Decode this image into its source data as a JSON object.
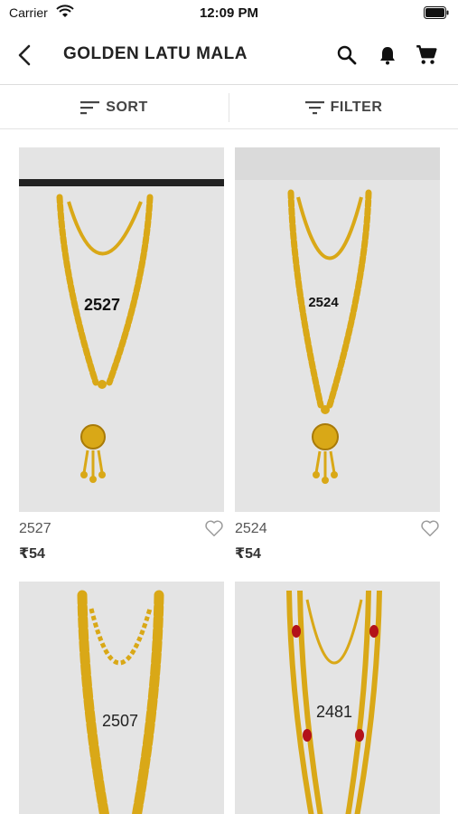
{
  "status_bar": {
    "carrier": "Carrier",
    "time": "12:09 PM"
  },
  "header": {
    "title": "GOLDEN LATU MALA"
  },
  "icons": {
    "back": "chevron-left-icon",
    "search": "search-icon",
    "notifications": "bell-icon",
    "cart": "cart-icon",
    "sort": "sort-lines-icon",
    "filter": "filter-lines-icon",
    "wishlist": "heart-outline-icon"
  },
  "toolbar": {
    "sort_label": "SORT",
    "filter_label": "FILTER"
  },
  "products": [
    {
      "code": "2527",
      "price": "₹54",
      "image_label": "2527"
    },
    {
      "code": "2524",
      "price": "₹54",
      "image_label": "2524"
    },
    {
      "code": "",
      "price": "",
      "image_label": "2507"
    },
    {
      "code": "",
      "price": "",
      "image_label": "2481"
    }
  ],
  "colors": {
    "gold": "#d9a817",
    "gold_dark": "#a87a08",
    "background": "#e4e4e4",
    "text": "#222222"
  }
}
